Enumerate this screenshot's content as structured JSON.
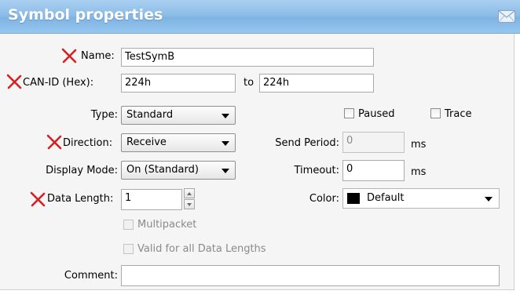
{
  "dialog": {
    "title": "Symbol properties"
  },
  "form": {
    "name_label": "Name:",
    "name_value": "TestSymB",
    "can_id_label": "CAN-ID (Hex):",
    "can_id_from": "224h",
    "to_label": "to",
    "can_id_to": "224h",
    "type_label": "Type:",
    "type_value": "Standard",
    "paused_label": "Paused",
    "trace_label": "Trace",
    "direction_label": "Direction:",
    "direction_value": "Receive",
    "send_period_label": "Send Period:",
    "send_period_value": "0",
    "send_period_unit": "ms",
    "display_mode_label": "Display Mode:",
    "display_mode_value": "On (Standard)",
    "timeout_label": "Timeout:",
    "timeout_value": "0",
    "timeout_unit": "ms",
    "data_length_label": "Data Length:",
    "data_length_value": "1",
    "color_label": "Color:",
    "color_value": "Default",
    "color_swatch": "#000000",
    "multipacket_label": "Multipacket",
    "valid_all_label": "Valid for all Data Lengths",
    "comment_label": "Comment:",
    "comment_value": ""
  },
  "state": {
    "paused": false,
    "trace": false,
    "multipacket": false,
    "valid_for_all_lengths": false
  },
  "colors": {
    "title_bar": "#8dbde8",
    "required_mark": "#d42020"
  }
}
